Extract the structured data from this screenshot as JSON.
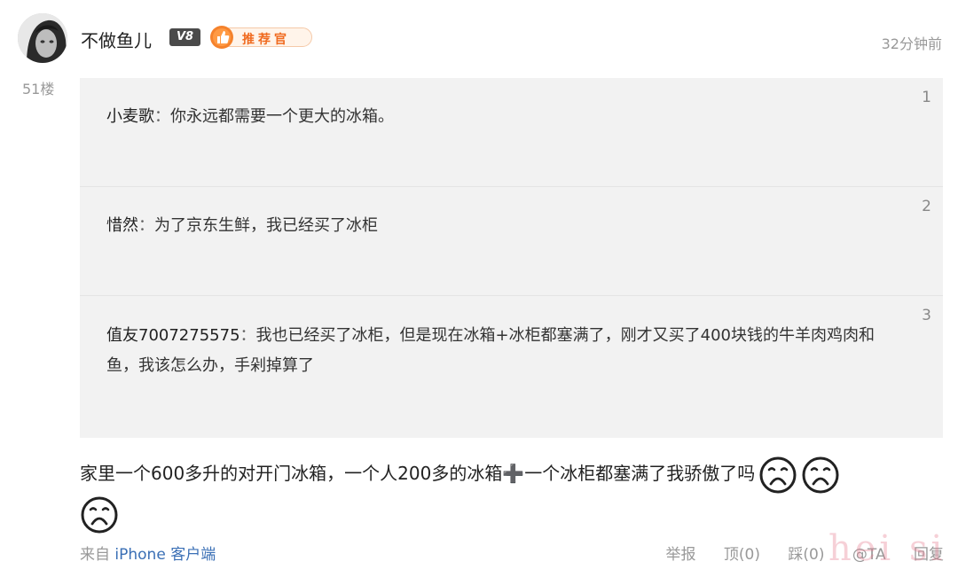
{
  "post": {
    "username": "不做鱼儿",
    "vip_level": "V8",
    "recommend_badge": "推荐官",
    "timestamp": "32分钟前",
    "floor": "51楼"
  },
  "quotes": [
    {
      "num": "1",
      "author": "小麦歌",
      "sep": "：",
      "text": "你永远都需要一个更大的冰箱。"
    },
    {
      "num": "2",
      "author": "惜然",
      "sep": "：",
      "text": "为了京东生鲜，我已经买了冰柜"
    },
    {
      "num": "3",
      "author": "值友7007275575",
      "sep": "：",
      "text": "我也已经买了冰柜，但是现在冰箱+冰柜都塞满了，刚才又买了400块钱的牛羊肉鸡肉和鱼，我该怎么办，手剁掉算了"
    }
  ],
  "main_comment": {
    "text": "家里一个600多升的对开门冰箱，一个人200多的冰箱➕一个冰柜都塞满了我骄傲了吗",
    "emojis": [
      "sad-face-icon",
      "sad-face-icon",
      "sad-face-icon"
    ]
  },
  "footer": {
    "source_prefix": "来自",
    "device": "iPhone 客户端",
    "report": "举报",
    "upvote": "顶(0)",
    "downvote": "踩(0)",
    "mention": "@TA",
    "reply": "回复"
  },
  "watermark": "hei si",
  "colors": {
    "accent_orange": "#f06a1f",
    "link_blue": "#3a6fb5",
    "quote_bg": "#f2f2f2"
  }
}
